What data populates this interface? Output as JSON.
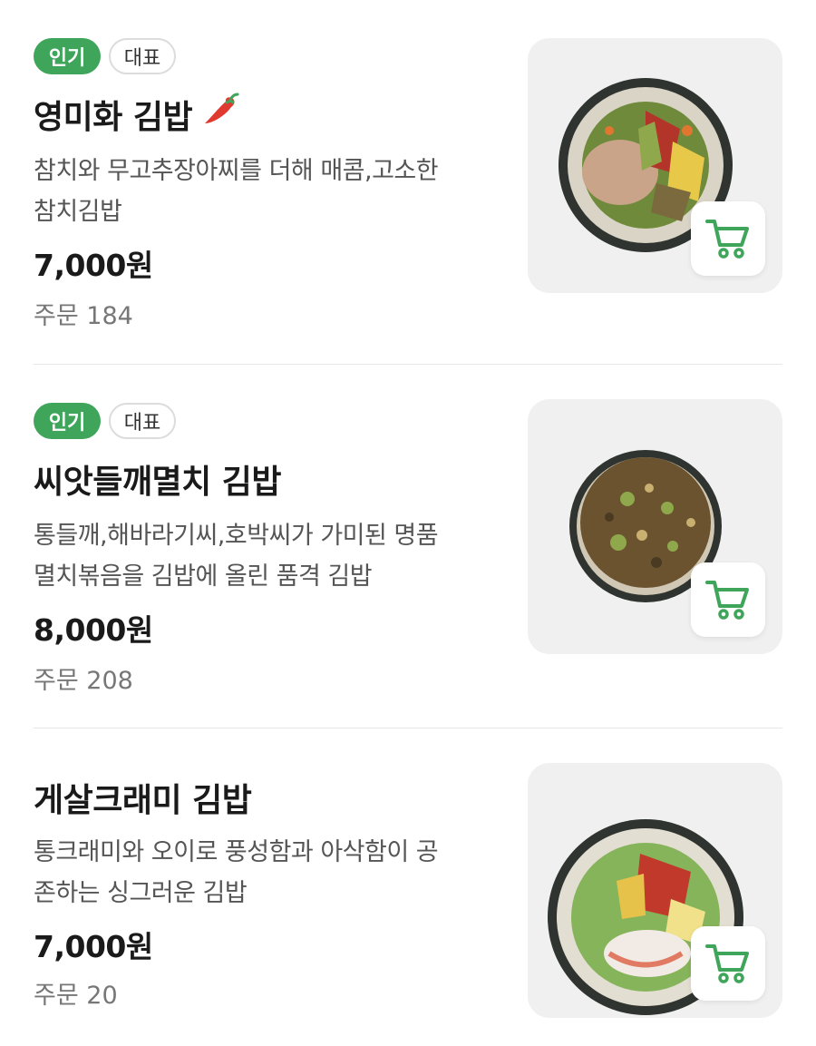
{
  "menu": {
    "items": [
      {
        "badges": [
          "인기",
          "대표"
        ],
        "name": "영미화 김밥",
        "spicy": true,
        "description_line1": "참치와 무고추장아찌를 더해 매콤,고소한",
        "description_line2": "참치김밥",
        "price": "7,000원",
        "orders": "주문 184",
        "icon": "cart-icon"
      },
      {
        "badges": [
          "인기",
          "대표"
        ],
        "name": "씨앗들깨멸치 김밥",
        "spicy": false,
        "description_line1": "통들깨,해바라기씨,호박씨가 가미된 명품",
        "description_line2": "멸치볶음을 김밥에 올린 품격 김밥",
        "price": "8,000원",
        "orders": "주문 208",
        "icon": "cart-icon"
      },
      {
        "badges": [],
        "name": "게살크래미 김밥",
        "spicy": false,
        "description_line1": "통크래미와 오이로 풍성함과 아삭함이 공",
        "description_line2": "존하는 싱그러운 김밥",
        "price": "7,000원",
        "orders": "주문 20",
        "icon": "cart-icon"
      }
    ]
  },
  "colors": {
    "accent": "#3fa55b",
    "text_primary": "#1a1a1a",
    "text_secondary": "#555555",
    "divider": "#e6e6e6"
  }
}
